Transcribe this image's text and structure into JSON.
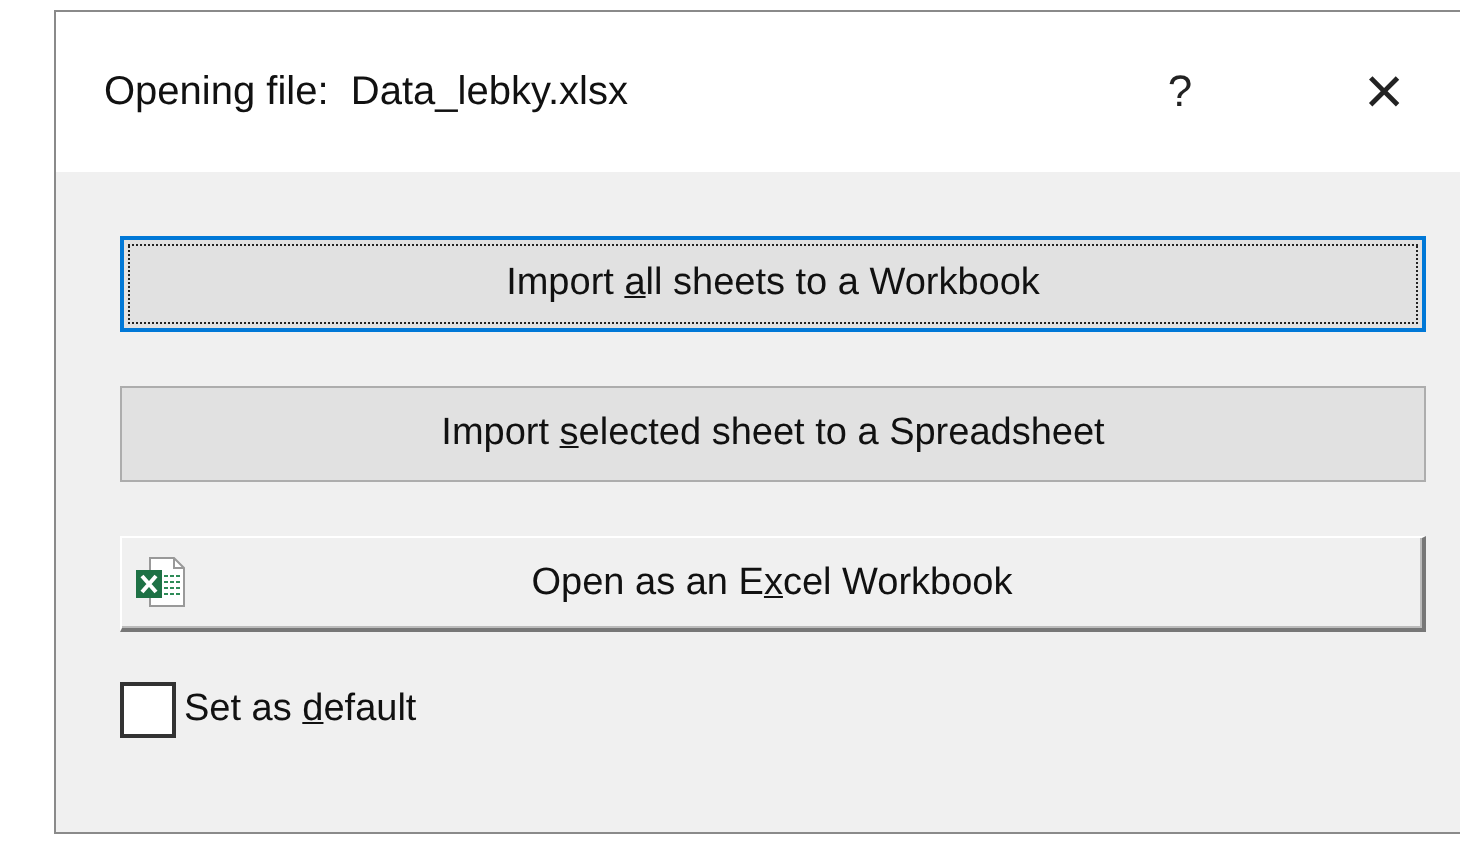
{
  "window": {
    "title": "Opening file:  Data_lebky.xlsx",
    "help": "?",
    "close": "×"
  },
  "buttons": [
    {
      "kind": "focused",
      "before": "Import ",
      "mnemonic": "a",
      "after": "ll sheets to a Workbook"
    },
    {
      "kind": "flat",
      "before": "Import ",
      "mnemonic": "s",
      "after": "elected sheet to a Spreadsheet"
    },
    {
      "kind": "raised",
      "before": "Open as an E",
      "mnemonic": "x",
      "after": "cel Workbook"
    }
  ],
  "checkbox": {
    "checked": false,
    "before": "Set as ",
    "mnemonic": "d",
    "after": "efault"
  }
}
